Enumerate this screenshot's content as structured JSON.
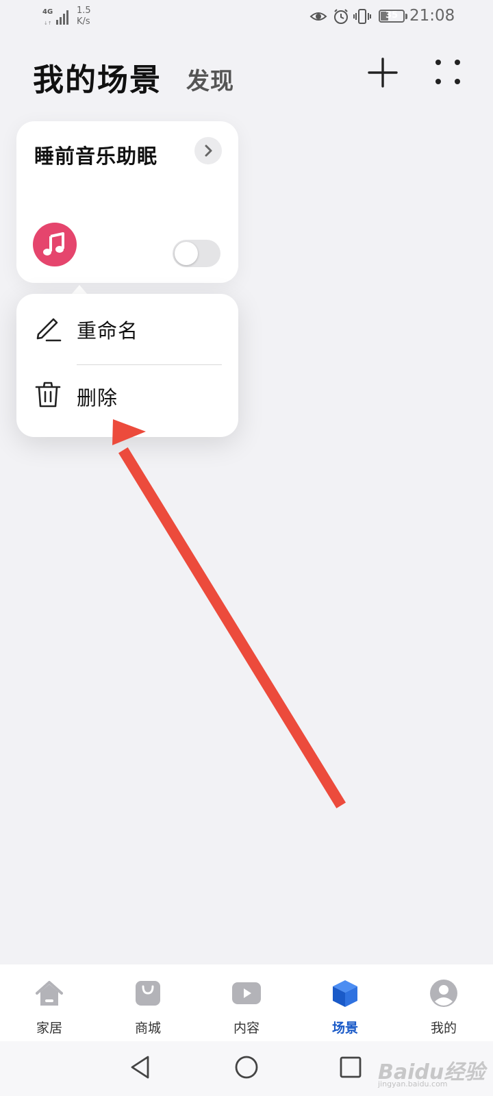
{
  "status_bar": {
    "network_type": "4G",
    "net_speed_value": "1.5",
    "net_speed_unit": "K/s",
    "battery_level": "35",
    "time": "21:08",
    "icons": [
      "eye-icon",
      "alarm-icon",
      "vibrate-icon",
      "battery-icon"
    ]
  },
  "header": {
    "title": "我的场景",
    "discover_tab": "发现",
    "add_icon": "plus-icon",
    "more_icon": "more-dots-icon"
  },
  "scene_card": {
    "name": "睡前音乐助眠",
    "icon": "music-note-icon",
    "icon_color": "#e5456d",
    "enabled": false
  },
  "context_menu": {
    "items": [
      {
        "label": "重命名",
        "icon": "pencil-icon"
      },
      {
        "label": "删除",
        "icon": "trash-icon"
      }
    ]
  },
  "annotation": {
    "arrow_color": "#ec4b3c"
  },
  "bottom_nav": {
    "active_index": 3,
    "active_color": "#1a5ac8",
    "items": [
      {
        "label": "家居",
        "icon": "home-icon"
      },
      {
        "label": "商城",
        "icon": "shopping-bag-icon"
      },
      {
        "label": "内容",
        "icon": "play-icon"
      },
      {
        "label": "场景",
        "icon": "cube-icon"
      },
      {
        "label": "我的",
        "icon": "profile-icon"
      }
    ]
  },
  "system_nav": {
    "icons": [
      "back-icon",
      "home-circle-icon",
      "recents-icon"
    ],
    "watermark": "Baidu经验",
    "watermark_url": "jingyan.baidu.com"
  }
}
